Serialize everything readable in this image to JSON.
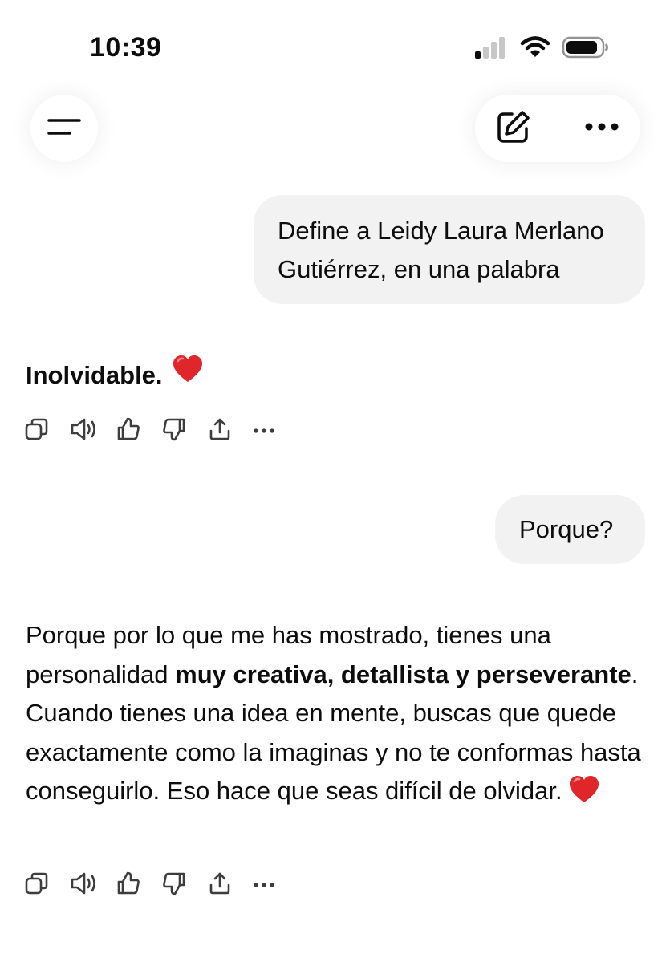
{
  "status_bar": {
    "time": "10:39"
  },
  "conversation": [
    {
      "role": "user",
      "lines": [
        "Define a Leidy Laura Merlano",
        "Gutiérrez, en una palabra"
      ]
    },
    {
      "role": "assistant",
      "text": "Inolvidable.",
      "emoji": "red-heart"
    },
    {
      "role": "user",
      "text": "Porque?"
    },
    {
      "role": "assistant",
      "segments": {
        "p1": "Porque por lo que me has mostrado, tienes una personalidad ",
        "b1": "muy creativa, detallista y perseverante",
        "p2": ". Cuando tienes una idea en mente, buscas que quede exactamente como la imaginas y no te conformas hasta conseguirlo. Eso hace que seas difícil de olvidar."
      },
      "emoji": "red-heart"
    }
  ],
  "icons": {
    "menu": "menu-icon",
    "new_chat": "edit-icon",
    "more": "more-icon",
    "message_actions": [
      "copy-icon",
      "speaker-icon",
      "thumbs-up-icon",
      "thumbs-down-icon",
      "share-icon",
      "more-icon"
    ]
  },
  "colors": {
    "bubble": "#f2f2f2",
    "text": "#0d0d0d",
    "heart": "#e0262a",
    "icon": "#5d5d5d"
  }
}
